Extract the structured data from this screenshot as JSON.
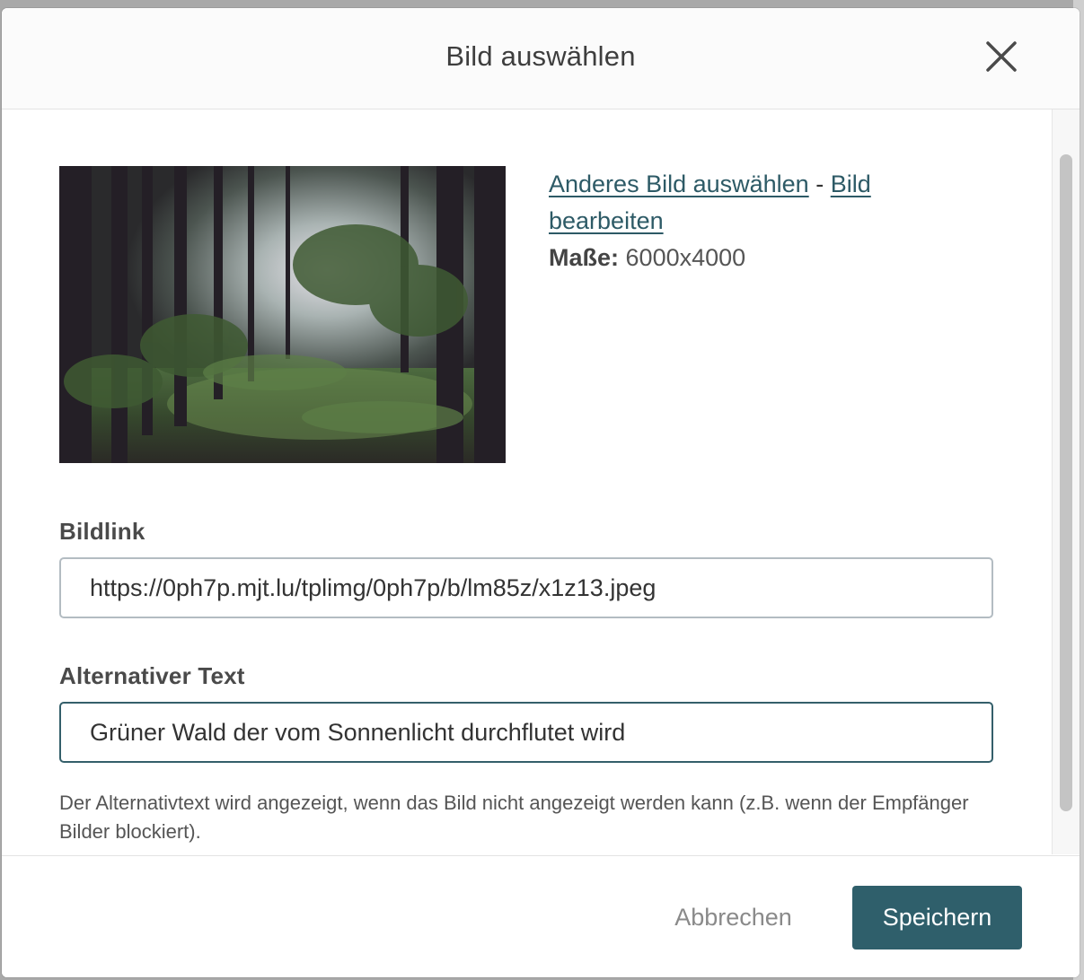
{
  "modal": {
    "title": "Bild auswählen"
  },
  "image": {
    "change_link": "Anderes Bild auswählen",
    "separator": "-",
    "edit_link": "Bild bearbeiten",
    "dimensions_label": "Maße:",
    "dimensions_value": "6000x4000"
  },
  "fields": {
    "image_link_label": "Bildlink",
    "image_link_value": "https://0ph7p.mjt.lu/tplimg/0ph7p/b/lm85z/x1z13.jpeg",
    "alt_text_label": "Alternativer Text",
    "alt_text_value": "Grüner Wald der vom Sonnenlicht durchflutet wird",
    "alt_text_help": "Der Alternativtext wird angezeigt, wenn das Bild nicht angezeigt werden kann (z.B. wenn der Empfänger Bilder blockiert)."
  },
  "footer": {
    "cancel_label": "Abbrechen",
    "save_label": "Speichern"
  },
  "colors": {
    "accent": "#2f5f6b",
    "link": "#2d5a66"
  },
  "icons": {
    "close": "close-icon",
    "preview": "forest-image-preview"
  }
}
